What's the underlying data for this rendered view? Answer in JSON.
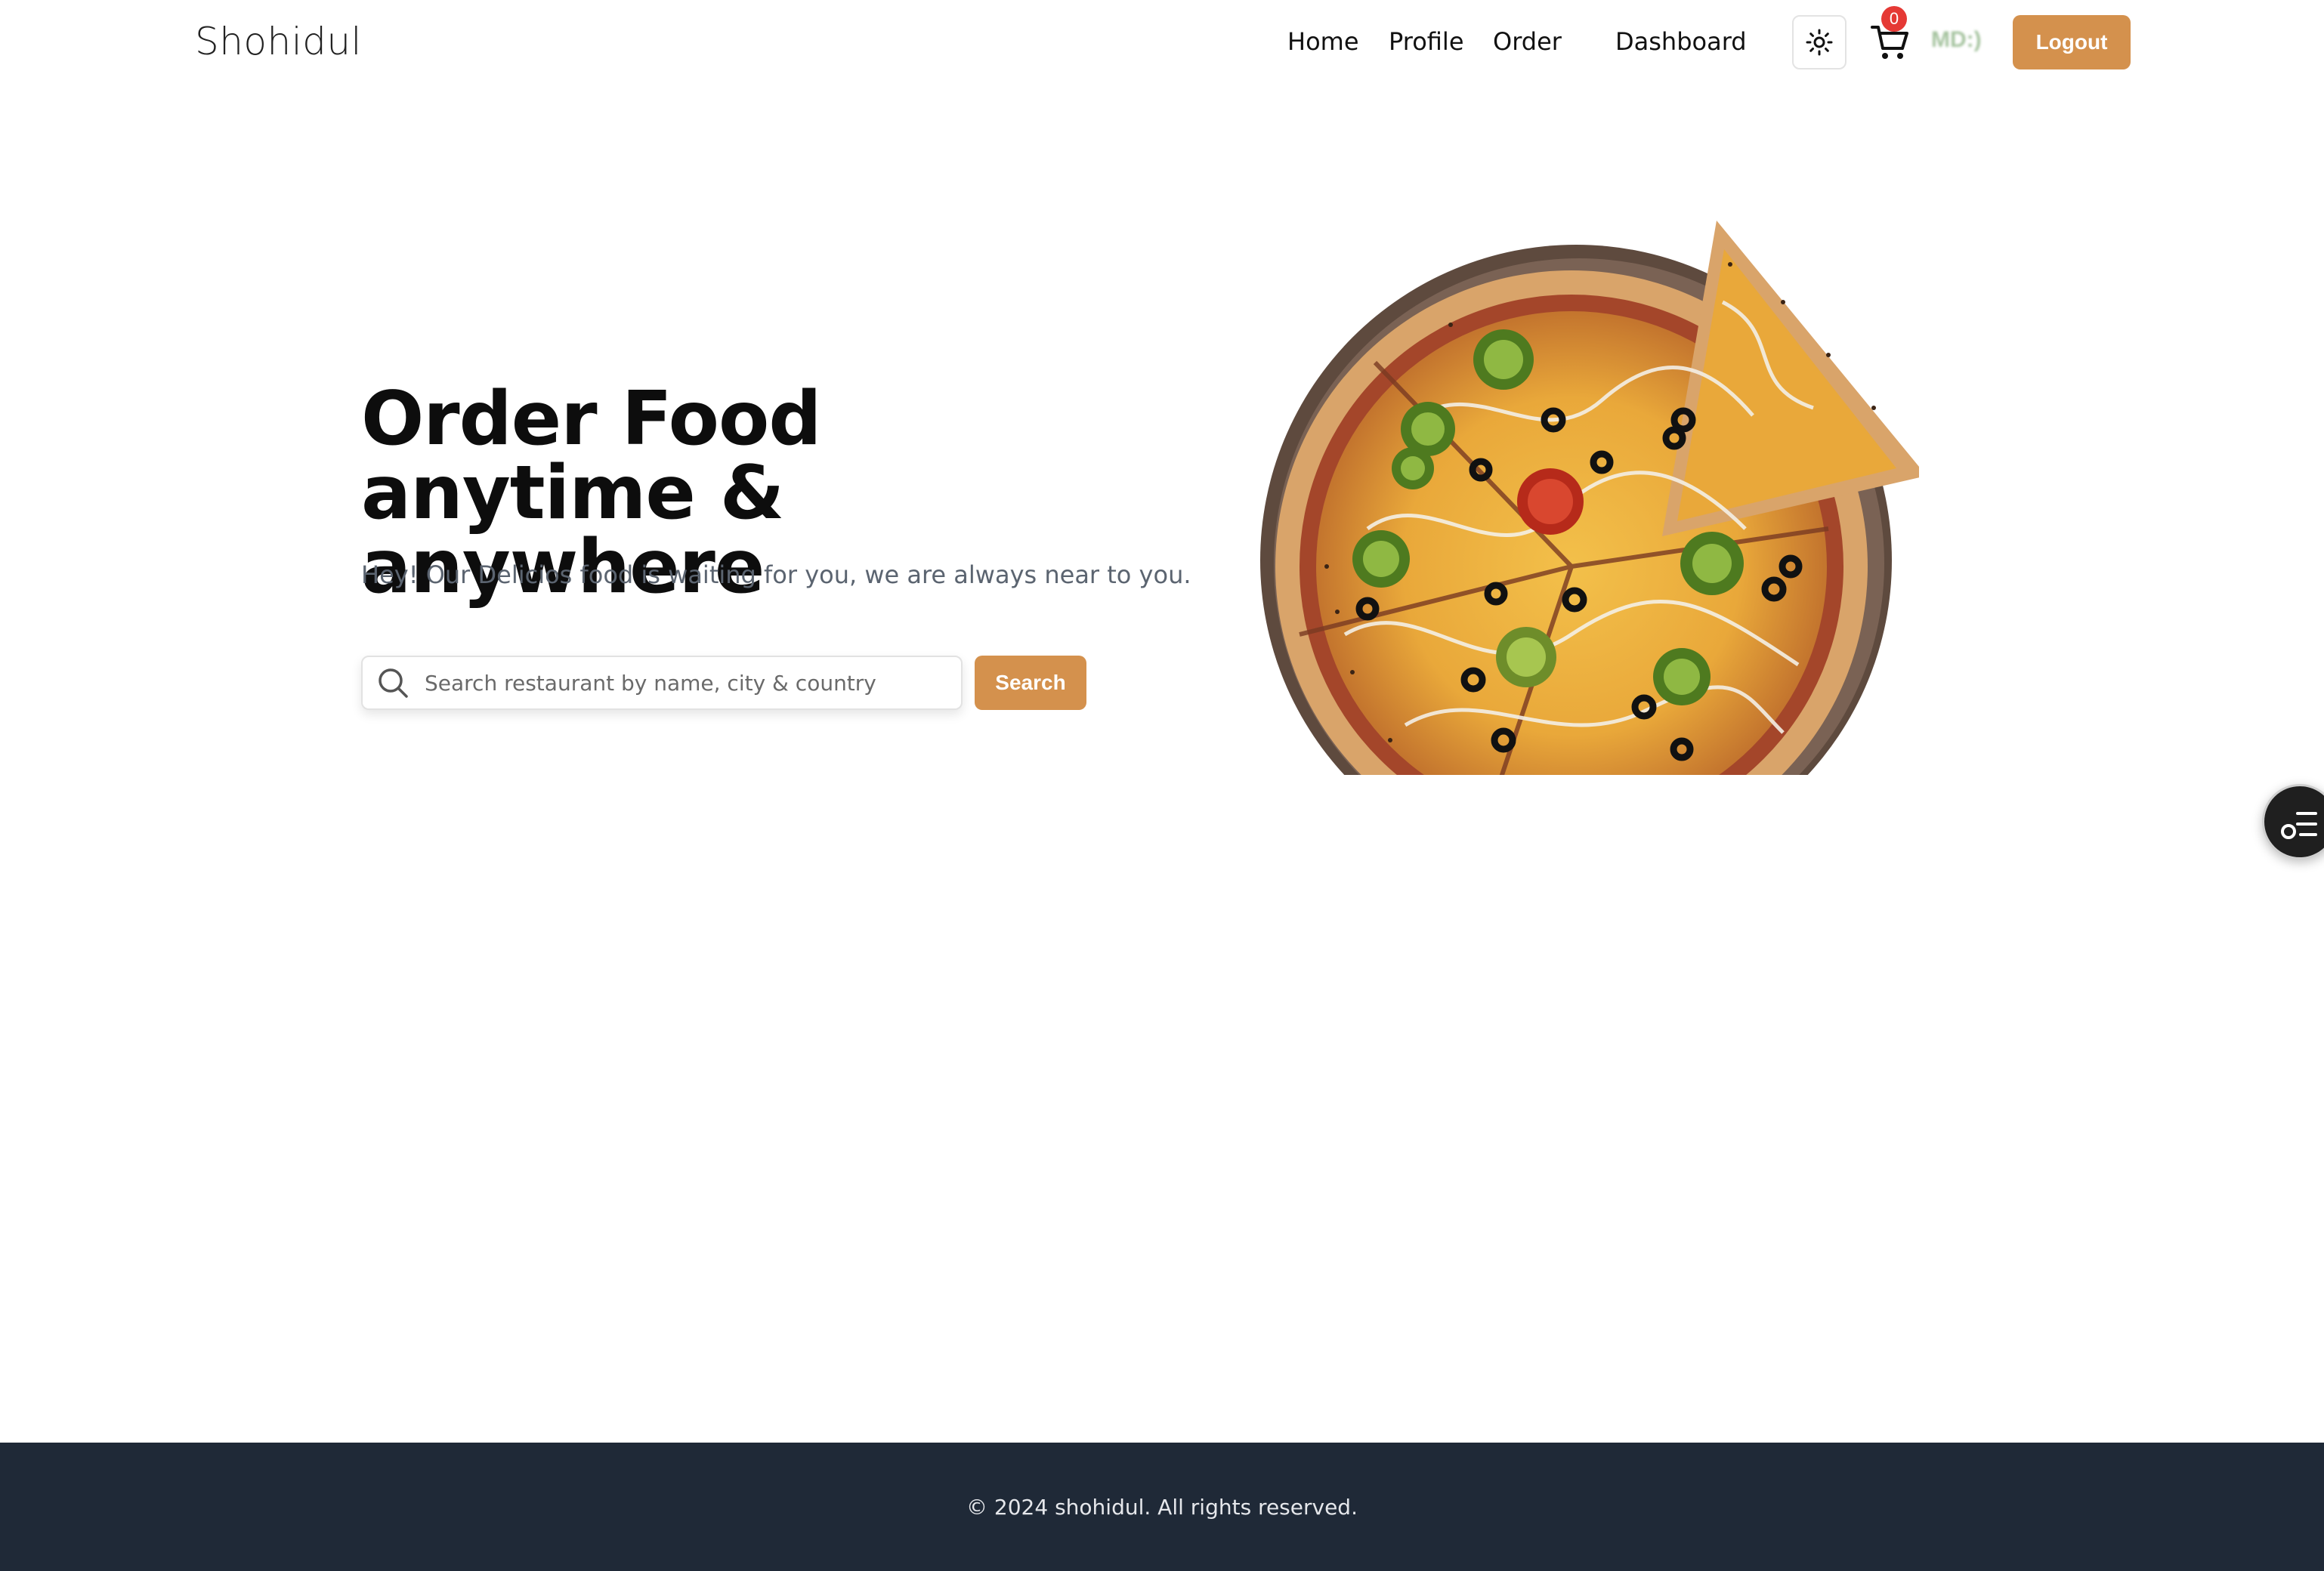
{
  "brand": {
    "name": "Shohidul"
  },
  "nav": {
    "items": [
      {
        "label": "Home"
      },
      {
        "label": "Profile"
      },
      {
        "label": "Order"
      },
      {
        "label": "Dashboard"
      }
    ],
    "theme_icon": "sun-icon",
    "cart_icon": "cart-icon",
    "cart_count": "0",
    "user_label": "MD:)",
    "logout_label": "Logout"
  },
  "hero": {
    "title": "Order Food anytime & anywhere",
    "subtitle": "Hey! Our Delicios food is waiting for you, we are always near to you.",
    "search": {
      "placeholder": "Search restaurant by name, city & country",
      "value": "",
      "icon": "search-icon",
      "button_label": "Search"
    },
    "image": "pizza-image"
  },
  "floating_button": {
    "icon": "menu-list-icon"
  },
  "footer": {
    "text": "© 2024 shohidul. All rights reserved."
  },
  "colors": {
    "accent": "#d4914d",
    "footer_bg": "#1f2937",
    "badge": "#e53935"
  }
}
